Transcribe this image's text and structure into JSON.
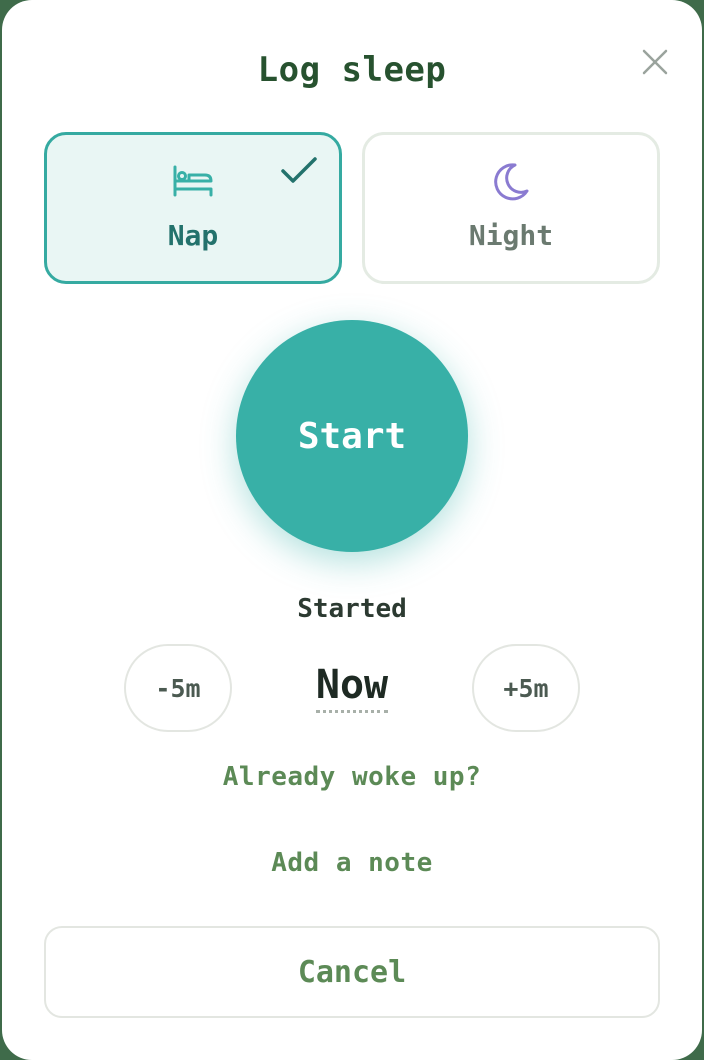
{
  "dialog": {
    "title": "Log sleep",
    "close_icon": "close-icon"
  },
  "sleep_types": [
    {
      "label": "Nap",
      "icon": "bed-icon",
      "selected": true
    },
    {
      "label": "Night",
      "icon": "moon-icon",
      "selected": false
    }
  ],
  "start_button": {
    "label": "Start"
  },
  "started": {
    "label": "Started",
    "minus_label": "-5m",
    "time_value": "Now",
    "plus_label": "+5m"
  },
  "links": {
    "already_woke": "Already woke up?",
    "add_note": "Add a note"
  },
  "cancel_button": {
    "label": "Cancel"
  },
  "colors": {
    "accent": "#38b0a7",
    "selected_border": "#35aaa1",
    "title": "#27522f",
    "link": "#5c8a56",
    "moon": "#8a7bd1"
  }
}
